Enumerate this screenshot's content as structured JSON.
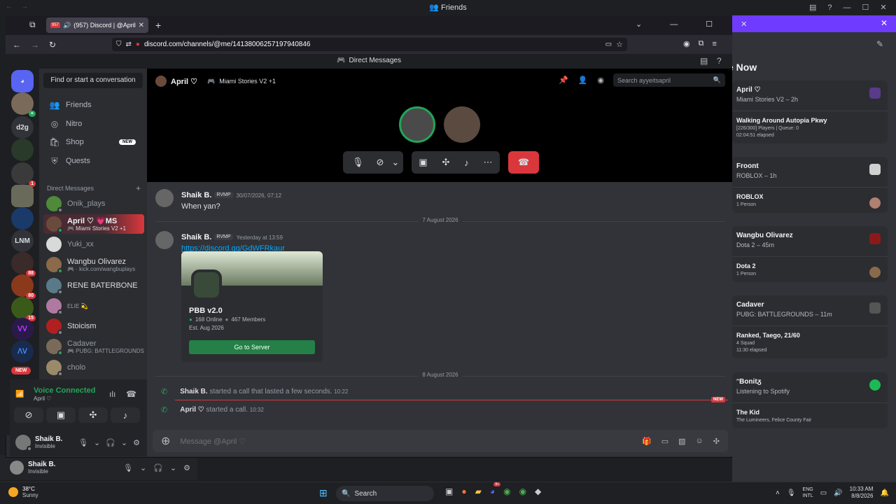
{
  "outer_window": {
    "title": "Friends"
  },
  "active_now": {
    "title": "e Now",
    "cards": [
      {
        "name": "April ♡",
        "sub": "Miami Stories V2 – 2h",
        "activity": "Walking Around Autopia Pkwy",
        "detail1": "[226/300] Players | Queue: 0",
        "detail2": "02:04:51 elapsed"
      },
      {
        "name": "Froont",
        "sub": "ROBLOX – 1h",
        "activity": "ROBLOX",
        "detail1": "1 Person",
        "detail2": ""
      },
      {
        "name": "Wangbu Olivarez",
        "sub": "Dota 2 – 45m",
        "activity": "Dota 2",
        "detail1": "1 Person",
        "detail2": ""
      },
      {
        "name": "Cadaver",
        "sub": "PUBG: BATTLEGROUNDS – 11m",
        "activity": "Ranked, Taego, 21/60",
        "detail1": "4 Squad",
        "detail2": "11:30 elapsed"
      },
      {
        "name": "ᵔBonitᵹ",
        "sub": "Listening to Spotify",
        "activity": "The Kid",
        "detail1": "The Lumineers, Felice County Fair",
        "detail2": ""
      }
    ]
  },
  "browser": {
    "tab_title": "(957) Discord | @April ♡",
    "tab_badge": "957",
    "url": "discord.com/channels/@me/1413800625719794084​6",
    "url_display": "discord.com/channels/@me/1413800625719794084​6"
  },
  "discord": {
    "title": "Direct Messages",
    "find_placeholder": "Find or start a conversation",
    "nav": [
      {
        "label": "Friends",
        "icon": "friends-icon"
      },
      {
        "label": "Nitro",
        "icon": "nitro-icon"
      },
      {
        "label": "Shop",
        "icon": "shop-icon",
        "badge": "NEW"
      },
      {
        "label": "Quests",
        "icon": "quests-icon"
      }
    ],
    "dm_header": "Direct Messages",
    "dms": [
      {
        "name": "Onik_plays",
        "sub": "",
        "color": "#4e8a3a"
      },
      {
        "name": "April ♡ 💗MS",
        "sub": "🎮 Miami Stories V2 +1",
        "color": "#6b4a3e"
      },
      {
        "name": "Yuki_xx",
        "sub": "",
        "color": "#d9d9d9"
      },
      {
        "name": "Wangbu Olivarez",
        "sub": "🎮 · kick.com/wangbuplays",
        "color": "#8a6a4a"
      },
      {
        "name": "RENE BATERBONE",
        "sub": "",
        "color": "#5a7a8a"
      },
      {
        "name": "ELIE 💫",
        "sub": "",
        "color": "#b07aa0"
      },
      {
        "name": "Stoicism",
        "sub": "",
        "color": "#b02020"
      },
      {
        "name": "Cadaver",
        "sub": "🎮 PUBG: BATTLEGROUNDS",
        "color": "#7a6a5a"
      },
      {
        "name": "cholo",
        "sub": "",
        "color": "#9a8a6a"
      }
    ],
    "guild_labels": [
      "d2g",
      "LNM"
    ],
    "guild_badges": [
      "1",
      "88",
      "80",
      "15"
    ],
    "new_label": "NEW",
    "voice": {
      "status": "Voice Connected",
      "channel": "April ♡"
    },
    "user": {
      "name": "Shaik B.",
      "status": "Invisible"
    },
    "header": {
      "name": "April ♡",
      "activity": "Miami Stories V2 +1",
      "search_placeholder": "Search ayyeitsapril"
    },
    "messages": [
      {
        "author": "Shaik B.",
        "tag": "RVMP",
        "time": "30/07/2026, 07:12",
        "text": "When yan?"
      },
      {
        "author": "Shaik B.",
        "tag": "RVMP",
        "time": "Yesterday at 13:59",
        "link": "https://discord.gg/GdWFRkaur"
      }
    ],
    "date1": "7 August 2026",
    "date2": "8 August 2026",
    "invite": {
      "server": "PBB v2.0",
      "online": "168 Online",
      "members": "467 Members",
      "est": "Est. Aug 2026",
      "button": "Go to Server"
    },
    "calls": [
      {
        "author": "Shaik B.",
        "text": "started a call that lasted a few seconds.",
        "time": "10:22"
      },
      {
        "author": "April ♡",
        "text": "started a call.",
        "time": "10:32"
      }
    ],
    "new_badge": "NEW",
    "message_placeholder": "Message @April ♡"
  },
  "outer_user": {
    "name": "Shaik B.",
    "status": "Invisible"
  },
  "taskbar": {
    "weather_temp": "38°C",
    "weather_desc": "Sunny",
    "search": "Search",
    "lang1": "ENG",
    "lang2": "INTL",
    "time": "10:33 AM",
    "date": "8/8/2026",
    "discord_badge": "9+"
  },
  "colors": {
    "accent": "#5865f2",
    "red": "#da373c",
    "green": "#248046",
    "banner": "#6f3bff"
  }
}
